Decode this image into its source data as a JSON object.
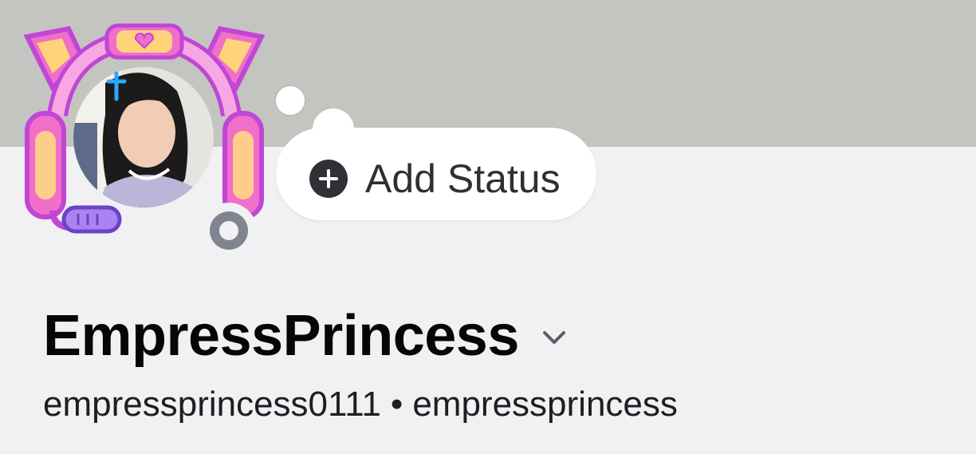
{
  "profile": {
    "display_name": "EmpressPrincess",
    "username": "empressprincess0111",
    "separator": "•",
    "pronouns_or_alias": "empressprincess",
    "online_status": "offline"
  },
  "status_button": {
    "label": "Add Status"
  },
  "icons": {
    "add": "plus-circle-icon",
    "expand": "chevron-down-icon",
    "status": "offline-status-icon"
  },
  "colors": {
    "banner": "#c4c4c0",
    "background": "#f1f1f3",
    "status_offline": "#80848e",
    "text_primary": "#060607"
  }
}
